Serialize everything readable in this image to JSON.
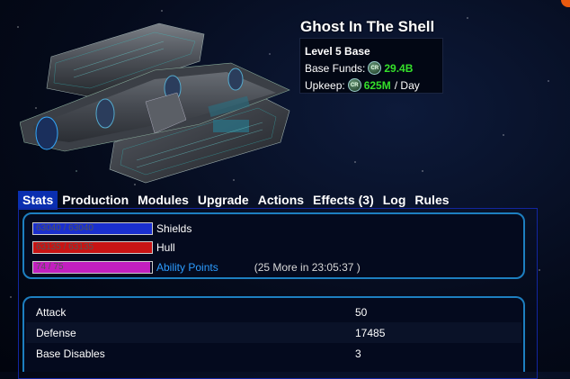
{
  "base": {
    "name": "Ghost In The Shell",
    "level": "Level 5 Base",
    "funds_label": "Base Funds:",
    "funds_value": "29.4B",
    "upkeep_label": "Upkeep:",
    "upkeep_value": "625M",
    "upkeep_suffix": "/ Day",
    "coin_icon_text": "CR"
  },
  "tabs": [
    {
      "label": "Stats",
      "active": true
    },
    {
      "label": "Production",
      "active": false
    },
    {
      "label": "Modules",
      "active": false
    },
    {
      "label": "Upgrade",
      "active": false
    },
    {
      "label": "Actions",
      "active": false
    },
    {
      "label": "Effects (3)",
      "active": false
    },
    {
      "label": "Log",
      "active": false
    },
    {
      "label": "Rules",
      "active": false
    }
  ],
  "bars": {
    "shields": {
      "text": "63040 / 63040",
      "label": "Shields",
      "fraction": 1.0,
      "color": "#1a2fcf"
    },
    "hull": {
      "text": "63135 / 63135",
      "label": "Hull",
      "fraction": 1.0,
      "color": "#c81414"
    },
    "ability": {
      "text": "74 / 75",
      "label": "Ability Points",
      "fraction": 0.987,
      "color": "#c21fbf",
      "more": "(25 More in 23:05:37 )"
    }
  },
  "stats": [
    {
      "name": "Attack",
      "value": "50"
    },
    {
      "name": "Defense",
      "value": "17485"
    },
    {
      "name": "Base Disables",
      "value": "3"
    }
  ],
  "colors": {
    "accent_tab": "#0a2fb0",
    "box_border": "#1d7fc0",
    "funds_green": "#35e02a",
    "ability_label_blue": "#2c9cff"
  }
}
